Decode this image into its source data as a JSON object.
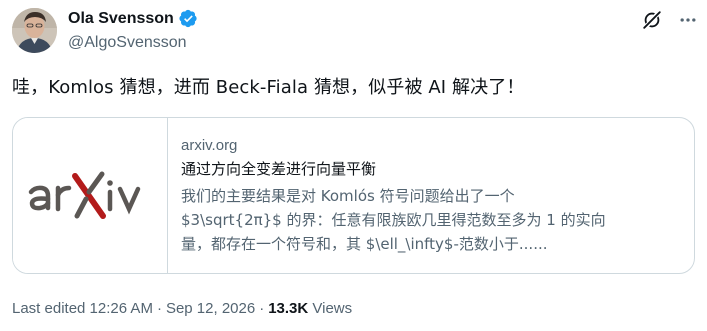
{
  "author": {
    "display_name": "Ola Svensson",
    "handle": "@AlgoSvensson",
    "verified_color": "#1d9bf0"
  },
  "header": {
    "icons": [
      "grok-icon",
      "more-options-icon"
    ]
  },
  "tweet": {
    "text": "哇，Komlos 猜想，进而 Beck-Fiala 猜想，似乎被 AI 解决了！"
  },
  "card": {
    "thumbnail_logo": "arXiv",
    "logo_colors": {
      "text": "#5b5754",
      "x": "#b31b1b"
    },
    "domain": "arxiv.org",
    "title": "通过方向全变差进行向量平衡",
    "description_lines": [
      "我们的主要结果是对 Komlós 符号问题给出了一个",
      "$3\\sqrt{2π}$ 的界：任意有限族欧几里得范数至多为 1 的实向",
      "量，都存在一个符号和，其 $\\ell_\\infty$-范数小于......"
    ]
  },
  "meta": {
    "edited": "Last edited 12:26 AM",
    "date": "Sep 12, 2026",
    "views_count": "13.3K",
    "views_label": "Views"
  }
}
